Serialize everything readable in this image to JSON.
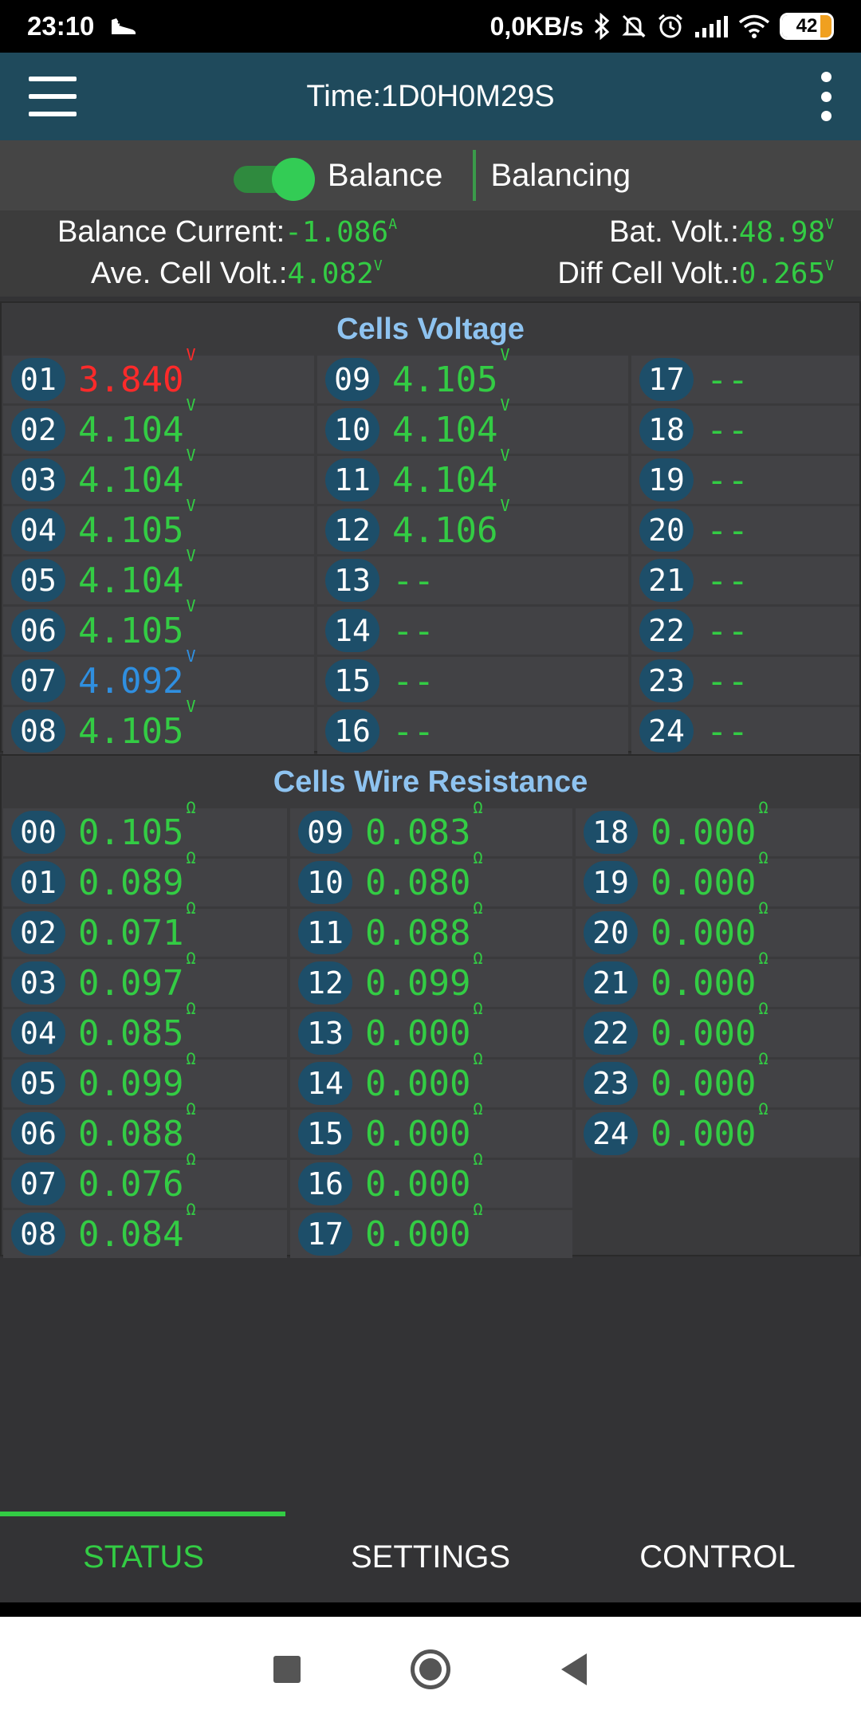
{
  "status_bar": {
    "time": "23:10",
    "network_speed": "0,0KB/s",
    "battery": "42",
    "icons": [
      "shoe-icon",
      "bluetooth-icon",
      "mute-icon",
      "alarm-icon",
      "signal-icon",
      "wifi-icon"
    ]
  },
  "app_bar": {
    "title": "Time:1D0H0M29S",
    "menu_icon": "hamburger-menu-icon",
    "more_icon": "more-vertical-icon"
  },
  "balance": {
    "toggle_on": true,
    "label": "Balance",
    "state": "Balancing",
    "accent": "#33cc55"
  },
  "summary": {
    "balance_current_label": "Balance Current:",
    "balance_current_value": "-1.086",
    "balance_current_unit": "A",
    "bat_volt_label": "Bat. Volt.:",
    "bat_volt_value": "48.98",
    "bat_volt_unit": "V",
    "ave_cell_label": "Ave. Cell Volt.:",
    "ave_cell_value": "4.082",
    "ave_cell_unit": "V",
    "diff_cell_label": "Diff Cell Volt.:",
    "diff_cell_value": "0.265",
    "diff_cell_unit": "V"
  },
  "cells_voltage": {
    "title": "Cells Voltage",
    "unit": "V",
    "colors": {
      "normal": "#33cc44",
      "max_low": "#ff2a2a",
      "min": "#2f8fe0"
    },
    "cells": [
      {
        "id": "01",
        "value": "3.840",
        "state": "max_low"
      },
      {
        "id": "02",
        "value": "4.104",
        "state": "normal"
      },
      {
        "id": "03",
        "value": "4.104",
        "state": "normal"
      },
      {
        "id": "04",
        "value": "4.105",
        "state": "normal"
      },
      {
        "id": "05",
        "value": "4.104",
        "state": "normal"
      },
      {
        "id": "06",
        "value": "4.105",
        "state": "normal"
      },
      {
        "id": "07",
        "value": "4.092",
        "state": "min"
      },
      {
        "id": "08",
        "value": "4.105",
        "state": "normal"
      },
      {
        "id": "09",
        "value": "4.105",
        "state": "normal"
      },
      {
        "id": "10",
        "value": "4.104",
        "state": "normal"
      },
      {
        "id": "11",
        "value": "4.104",
        "state": "normal"
      },
      {
        "id": "12",
        "value": "4.106",
        "state": "normal"
      },
      {
        "id": "13",
        "value": "--",
        "state": "empty"
      },
      {
        "id": "14",
        "value": "--",
        "state": "empty"
      },
      {
        "id": "15",
        "value": "--",
        "state": "empty"
      },
      {
        "id": "16",
        "value": "--",
        "state": "empty"
      },
      {
        "id": "17",
        "value": "--",
        "state": "empty"
      },
      {
        "id": "18",
        "value": "--",
        "state": "empty"
      },
      {
        "id": "19",
        "value": "--",
        "state": "empty"
      },
      {
        "id": "20",
        "value": "--",
        "state": "empty"
      },
      {
        "id": "21",
        "value": "--",
        "state": "empty"
      },
      {
        "id": "22",
        "value": "--",
        "state": "empty"
      },
      {
        "id": "23",
        "value": "--",
        "state": "empty"
      },
      {
        "id": "24",
        "value": "--",
        "state": "empty"
      }
    ]
  },
  "wire_resistance": {
    "title": "Cells Wire Resistance",
    "unit": "Ω",
    "cells": [
      {
        "id": "00",
        "value": "0.105"
      },
      {
        "id": "01",
        "value": "0.089"
      },
      {
        "id": "02",
        "value": "0.071"
      },
      {
        "id": "03",
        "value": "0.097"
      },
      {
        "id": "04",
        "value": "0.085"
      },
      {
        "id": "05",
        "value": "0.099"
      },
      {
        "id": "06",
        "value": "0.088"
      },
      {
        "id": "07",
        "value": "0.076"
      },
      {
        "id": "08",
        "value": "0.084"
      },
      {
        "id": "09",
        "value": "0.083"
      },
      {
        "id": "10",
        "value": "0.080"
      },
      {
        "id": "11",
        "value": "0.088"
      },
      {
        "id": "12",
        "value": "0.099"
      },
      {
        "id": "13",
        "value": "0.000"
      },
      {
        "id": "14",
        "value": "0.000"
      },
      {
        "id": "15",
        "value": "0.000"
      },
      {
        "id": "16",
        "value": "0.000"
      },
      {
        "id": "17",
        "value": "0.000"
      },
      {
        "id": "18",
        "value": "0.000"
      },
      {
        "id": "19",
        "value": "0.000"
      },
      {
        "id": "20",
        "value": "0.000"
      },
      {
        "id": "21",
        "value": "0.000"
      },
      {
        "id": "22",
        "value": "0.000"
      },
      {
        "id": "23",
        "value": "0.000"
      },
      {
        "id": "24",
        "value": "0.000"
      }
    ]
  },
  "tabs": [
    {
      "label": "STATUS",
      "active": true
    },
    {
      "label": "SETTINGS",
      "active": false
    },
    {
      "label": "CONTROL",
      "active": false
    }
  ],
  "nav_bar": {
    "recents_icon": "square-icon",
    "home_icon": "circle-icon",
    "back_icon": "triangle-back-icon"
  }
}
